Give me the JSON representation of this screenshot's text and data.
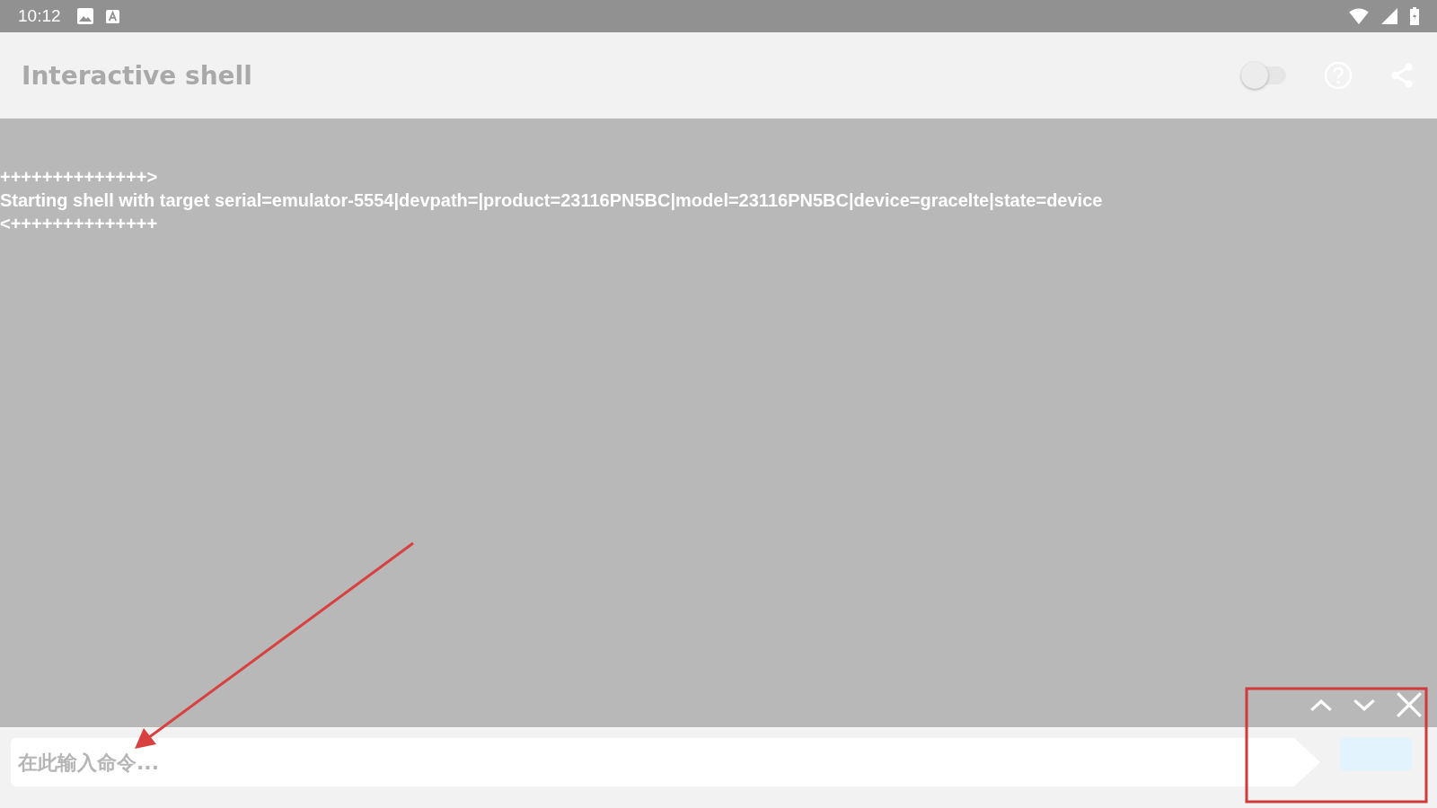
{
  "status_bar": {
    "time": "10:12"
  },
  "app_bar": {
    "title": "Interactive shell",
    "toggle": {
      "on": false
    }
  },
  "terminal": {
    "lines": [
      "++++++++++++++>",
      "Starting shell with target serial=emulator-5554|devpath=|product=23116PN5BC|model=23116PN5BC|device=gracelte|state=device",
      "<++++++++++++++"
    ]
  },
  "input": {
    "placeholder": "在此输入命令..."
  }
}
